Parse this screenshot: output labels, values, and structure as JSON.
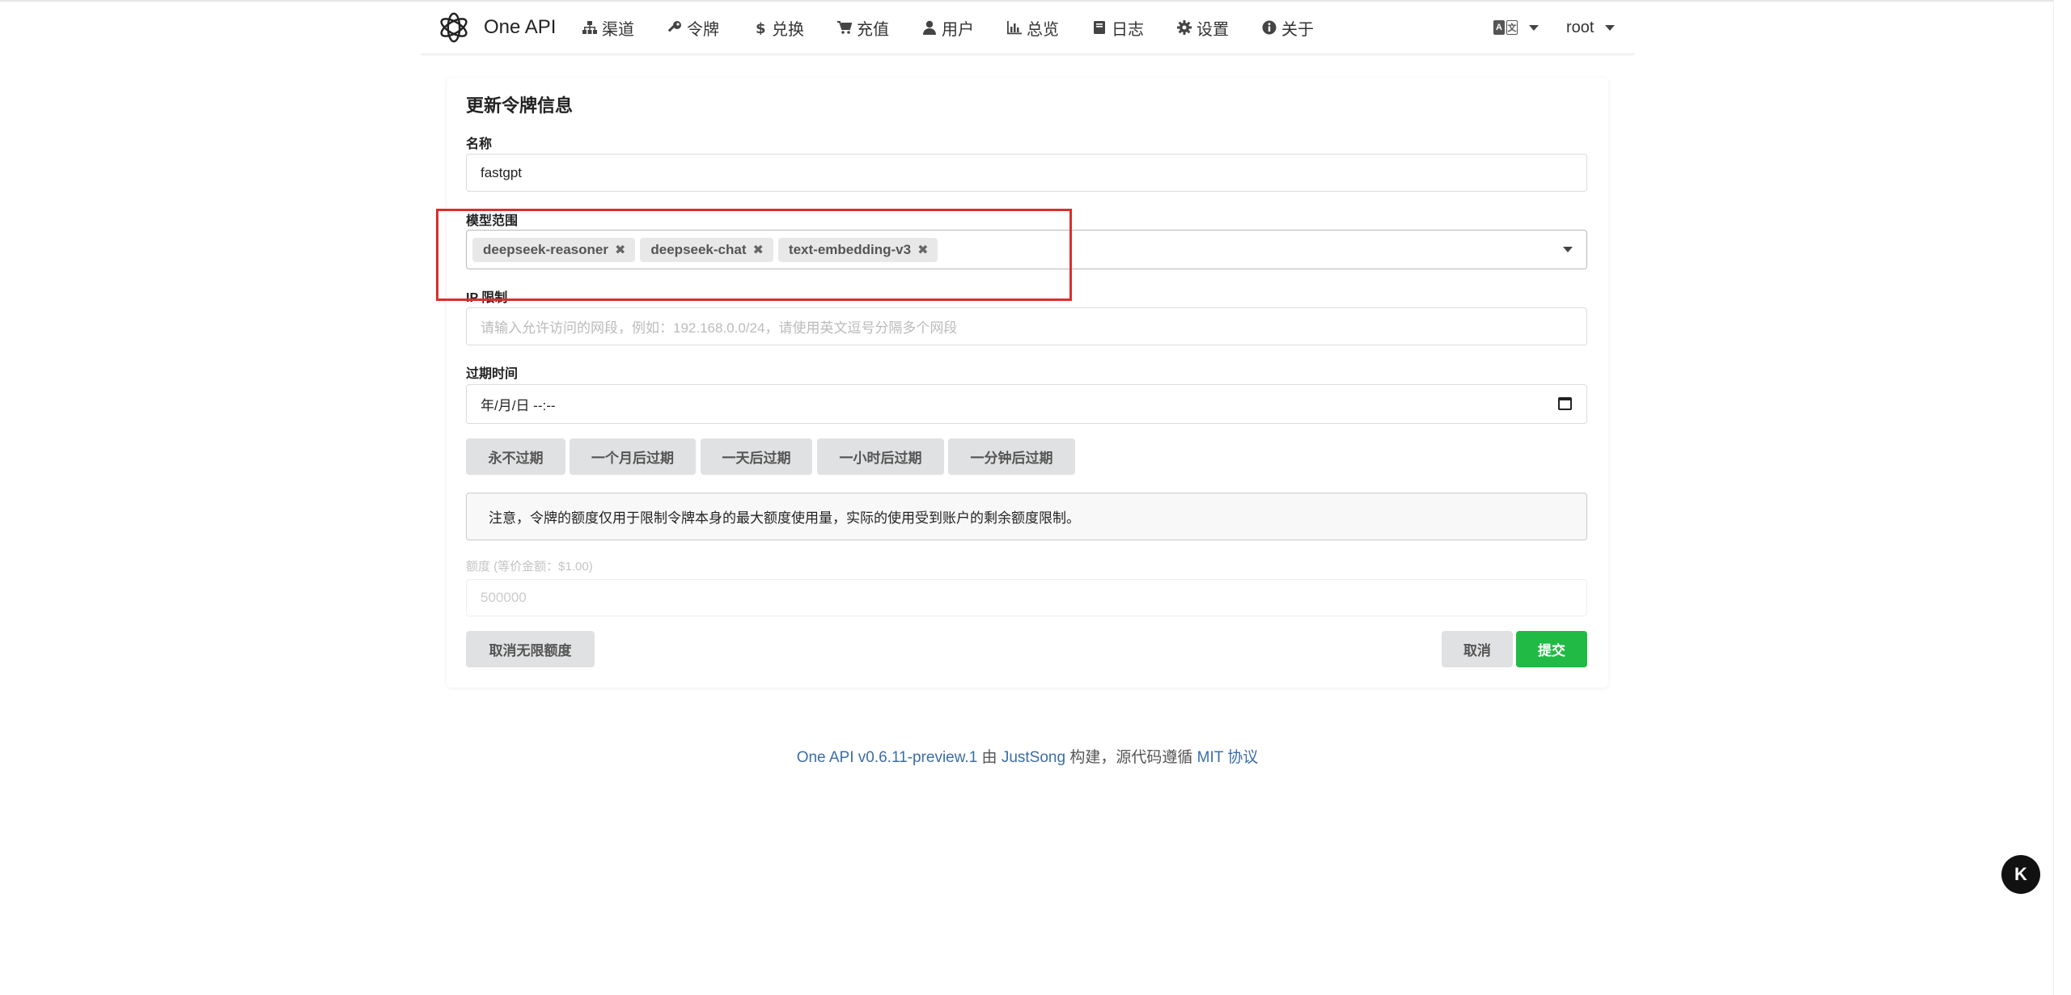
{
  "header": {
    "brand": "One API",
    "nav": [
      {
        "label": "渠道",
        "icon": "sitemap-icon"
      },
      {
        "label": "令牌",
        "icon": "key-icon"
      },
      {
        "label": "兑换",
        "icon": "dollar-icon"
      },
      {
        "label": "充值",
        "icon": "cart-icon"
      },
      {
        "label": "用户",
        "icon": "user-icon"
      },
      {
        "label": "总览",
        "icon": "bar-chart-icon"
      },
      {
        "label": "日志",
        "icon": "book-icon"
      },
      {
        "label": "设置",
        "icon": "gear-icon"
      },
      {
        "label": "关于",
        "icon": "info-icon"
      }
    ],
    "user": "root"
  },
  "form": {
    "title": "更新令牌信息",
    "name_label": "名称",
    "name_value": "fastgpt",
    "models_label": "模型范围",
    "models": [
      "deepseek-reasoner",
      "deepseek-chat",
      "text-embedding-v3"
    ],
    "ip_label": "IP 限制",
    "ip_placeholder": "请输入允许访问的网段，例如：192.168.0.0/24，请使用英文逗号分隔多个网段",
    "expiry_label": "过期时间",
    "expiry_value": "年/月/日 --:--",
    "expiry_buttons": [
      "永不过期",
      "一个月后过期",
      "一天后过期",
      "一小时后过期",
      "一分钟后过期"
    ],
    "notice": "注意，令牌的额度仅用于限制令牌本身的最大额度使用量，实际的使用受到账户的剩余额度限制。",
    "quota_label": "额度 (等价金额：$1.00)",
    "quota_value": "500000",
    "unlimited_button": "取消无限额度",
    "cancel_button": "取消",
    "submit_button": "提交"
  },
  "footer": {
    "version_link": "One API v0.6.11-preview.1",
    "by": " 由 ",
    "author_link": "JustSong",
    "middle": " 构建，源代码遵循 ",
    "license_link": "MIT 协议"
  },
  "floating_button": "K",
  "colors": {
    "primary": "#21ba45",
    "highlight": "#d9302b",
    "link": "#3b6da6"
  }
}
